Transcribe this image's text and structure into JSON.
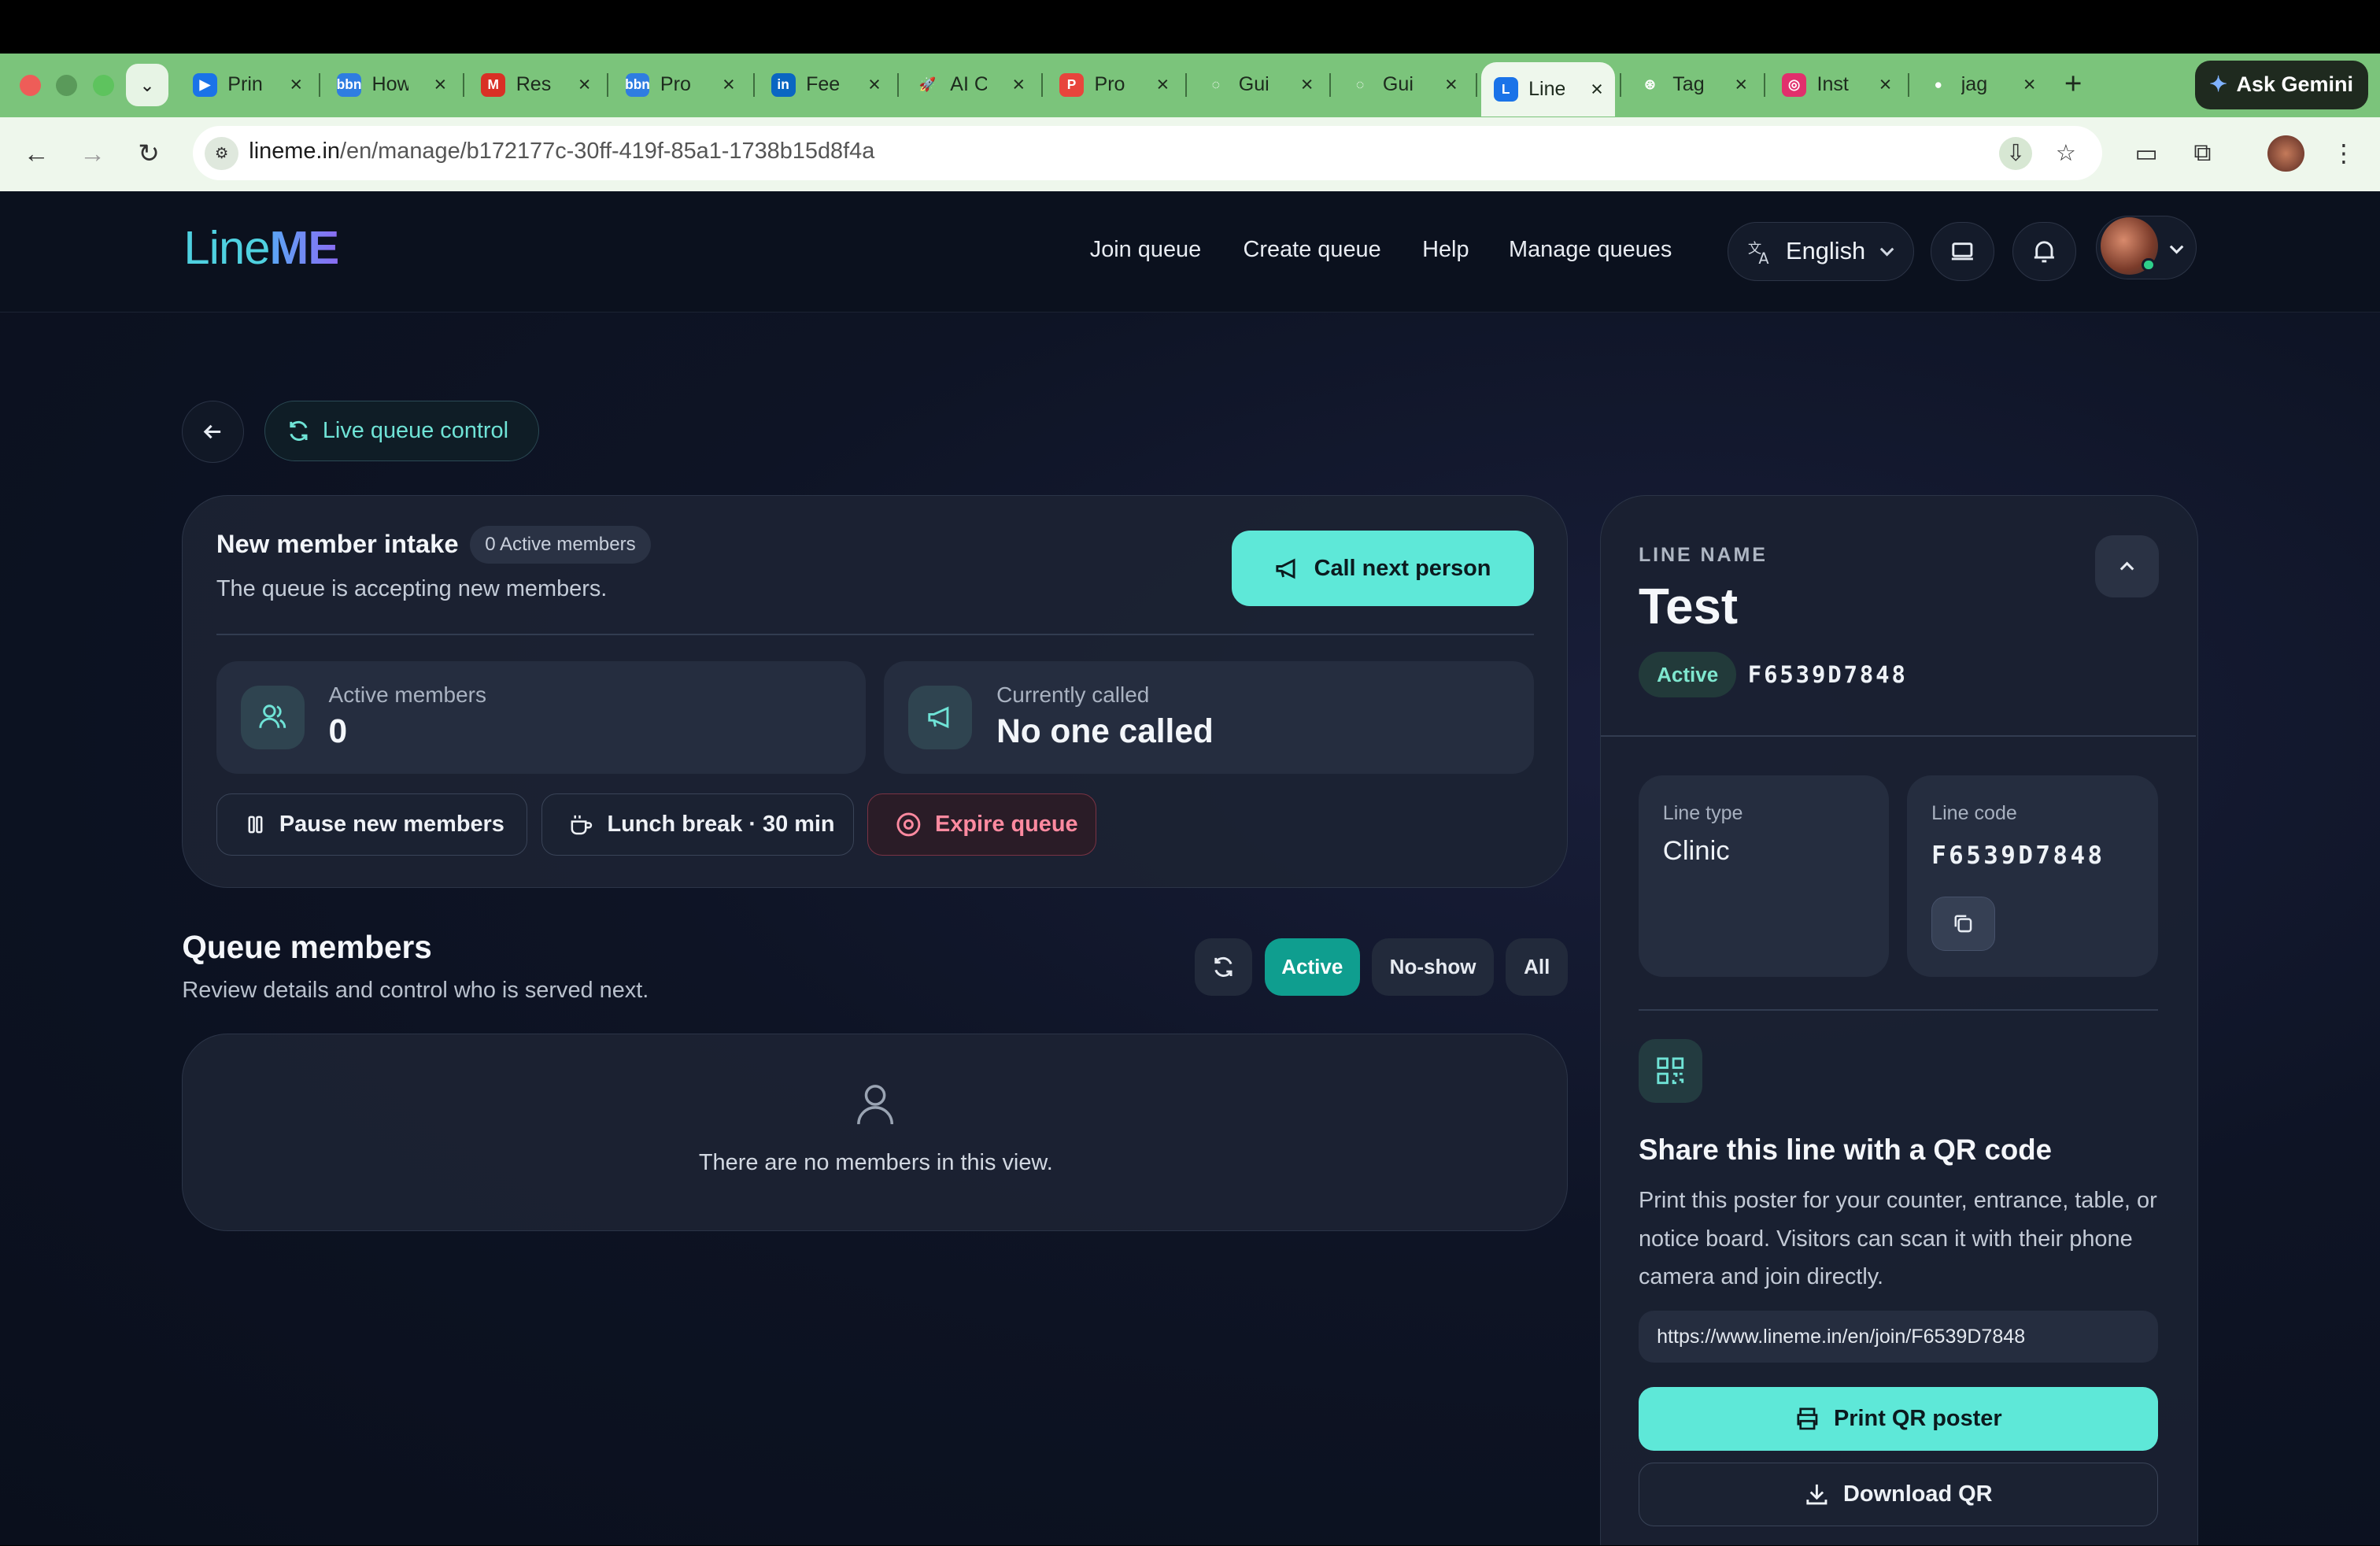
{
  "browser": {
    "tabs": [
      {
        "title": "Prin",
        "fav": "▶",
        "fav_color": "#1a73e8"
      },
      {
        "title": "How",
        "fav": "bbn",
        "fav_color": "#2f7de1"
      },
      {
        "title": "Res",
        "fav": "M",
        "fav_color": "#d93025"
      },
      {
        "title": "Pro",
        "fav": "bbn",
        "fav_color": "#2f7de1"
      },
      {
        "title": "Fee",
        "fav": "in",
        "fav_color": "#0a66c2"
      },
      {
        "title": "AI C",
        "fav": "🚀",
        "fav_color": "transparent"
      },
      {
        "title": "Pro",
        "fav": "P",
        "fav_color": "#e8453c"
      },
      {
        "title": "Gui",
        "fav": "◌",
        "fav_color": "transparent"
      },
      {
        "title": "Gui",
        "fav": "◌",
        "fav_color": "transparent"
      },
      {
        "title": "Line",
        "fav": "L",
        "fav_color": "#1a73e8"
      },
      {
        "title": "Tag",
        "fav": "⊛",
        "fav_color": "transparent"
      },
      {
        "title": "Inst",
        "fav": "◎",
        "fav_color": "#e1306c"
      },
      {
        "title": "jag",
        "fav": "●",
        "fav_color": "transparent"
      }
    ],
    "gemini_label": "Ask Gemini",
    "url_host": "lineme.in",
    "url_path": "/en/manage/b172177c-30ff-419f-85a1-1738b15d8f4a"
  },
  "nav": {
    "logo_light": "Line",
    "logo_bold": "ME",
    "links": [
      "Join queue",
      "Create queue",
      "Help",
      "Manage queues"
    ],
    "language": "English"
  },
  "page": {
    "live_label": "Live queue control"
  },
  "intake": {
    "title": "New member intake",
    "badge": "0 Active members",
    "subtitle": "The queue is accepting new members.",
    "call_next": "Call next person",
    "stats": [
      {
        "label": "Active members",
        "value": "0"
      },
      {
        "label": "Currently called",
        "value": "No one called"
      }
    ],
    "actions": {
      "pause": "Pause new members",
      "lunch": "Lunch break · 30 min",
      "expire": "Expire queue"
    }
  },
  "queue": {
    "title": "Queue members",
    "subtitle": "Review details and control who is served next.",
    "filters": [
      "Active",
      "No-show",
      "All"
    ],
    "active_filter": "Active",
    "empty_text": "There are no members in this view."
  },
  "side": {
    "line_name_label": "LINE NAME",
    "line_name": "Test",
    "status": "Active",
    "code": "F6539D7848",
    "line_type_label": "Line type",
    "line_type": "Clinic",
    "line_code_label": "Line code",
    "line_code": "F6539D7848",
    "share_title": "Share this line with a QR code",
    "share_desc": "Print this poster for your counter, entrance, table, or notice board. Visitors can scan it with their phone camera and join directly.",
    "join_url": "https://www.lineme.in/en/join/F6539D7848",
    "print_label": "Print QR poster",
    "download_label": "Download QR"
  },
  "colors": {
    "accent": "#5ee8d8",
    "background": "#0e1425",
    "danger": "#ff8aa0",
    "chrome_tabstrip": "#7bc47b"
  }
}
